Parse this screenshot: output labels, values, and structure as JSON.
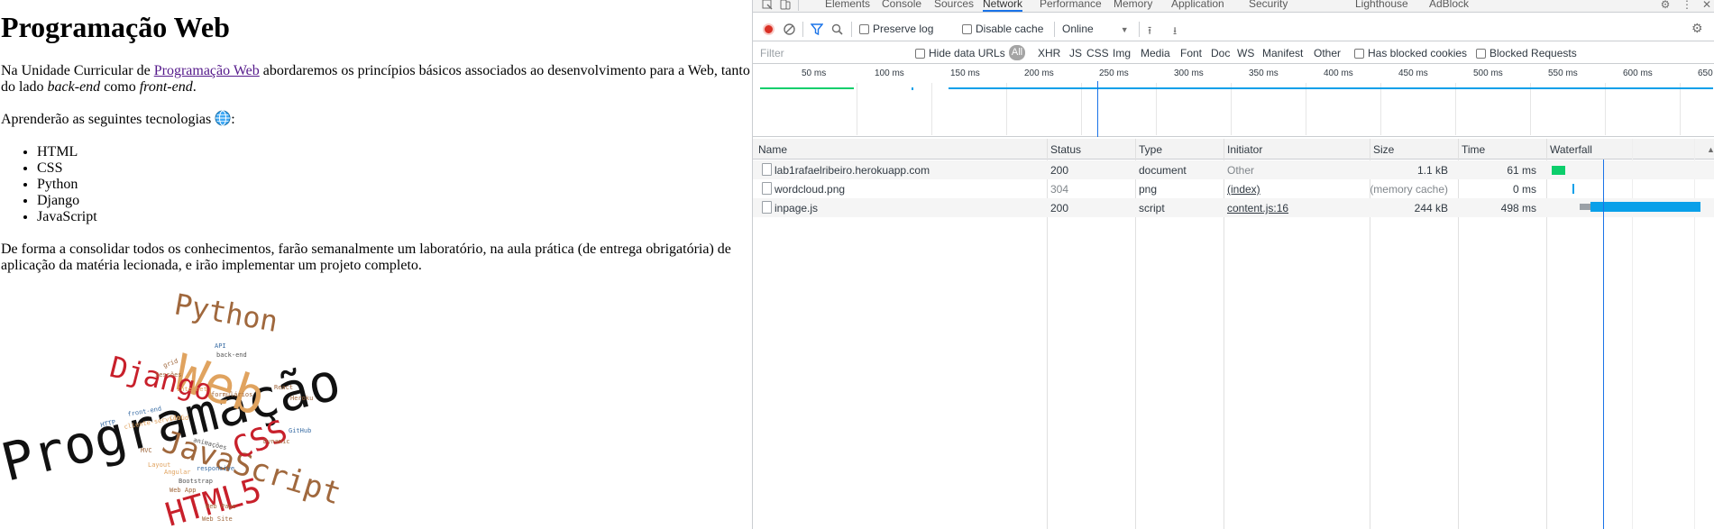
{
  "page": {
    "title": "Programação Web",
    "intro": {
      "before_link": "Na Unidade Curricular de ",
      "link_text": "Programação Web",
      "after_link": " abordaremos os princípios básicos associados ao desenvolvimento para a Web, tanto do lado ",
      "em1": "back-end",
      "middle": " como ",
      "em2": "front-end",
      "end": "."
    },
    "learn": {
      "text": "Aprenderão as seguintes tecnologias ",
      "suffix": ":"
    },
    "technologies": [
      "HTML",
      "CSS",
      "Python",
      "Django",
      "JavaScript"
    ],
    "closing": "De forma a consolidar todos os conhecimentos, farão semanalmente um laboratório, na aula prática (de entrega obrigatória) de aplicação da matéria lecionada, e irão implementar um projeto completo.",
    "wordcloud_words": [
      "Programação",
      "Web",
      "Python",
      "Django",
      "JavaScript",
      "CSS",
      "HTML5",
      "API",
      "back-end",
      "grid",
      "Sessões",
      "Internet",
      "formulários",
      "React",
      "HTTP",
      "front-end",
      "cliente-servidor",
      "MVC",
      "Cloud",
      "animações",
      "Heroku",
      "Layout",
      "Angular",
      "responsive",
      "Bootstrap",
      "Web App",
      "Web Page",
      "Web Site",
      "GitHub",
      "Dynamic"
    ]
  },
  "devtools": {
    "tabs": [
      "Elements",
      "Console",
      "Sources",
      "Network",
      "Performance",
      "Memory",
      "Application",
      "Security",
      "Lighthouse",
      "AdBlock"
    ],
    "active_tab": "Network",
    "toolbar": {
      "preserve_log": "Preserve log",
      "disable_cache": "Disable cache",
      "throttling": "Online"
    },
    "filter": {
      "placeholder": "Filter",
      "hide_data_urls": "Hide data URLs",
      "all": "All",
      "types": [
        "XHR",
        "JS",
        "CSS",
        "Img",
        "Media",
        "Font",
        "Doc",
        "WS",
        "Manifest",
        "Other"
      ],
      "has_blocked_cookies": "Has blocked cookies",
      "blocked_requests": "Blocked Requests"
    },
    "overview_ticks": [
      "50 ms",
      "100 ms",
      "150 ms",
      "200 ms",
      "250 ms",
      "300 ms",
      "350 ms",
      "400 ms",
      "450 ms",
      "500 ms",
      "550 ms",
      "600 ms",
      "650"
    ],
    "columns": [
      "Name",
      "Status",
      "Type",
      "Initiator",
      "Size",
      "Time",
      "Waterfall"
    ],
    "requests": [
      {
        "name": "lab1rafaelribeiro.herokuapp.com",
        "status": "200",
        "type": "document",
        "initiator": "Other",
        "size": "1.1 kB",
        "time": "61 ms"
      },
      {
        "name": "wordcloud.png",
        "status": "304",
        "type": "png",
        "initiator": "(index)",
        "size": "(memory cache)",
        "time": "0 ms"
      },
      {
        "name": "inpage.js",
        "status": "200",
        "type": "script",
        "initiator": "content.js:16",
        "size": "244 kB",
        "time": "498 ms"
      }
    ],
    "colors": {
      "record": "#d93025",
      "accent": "#1a73e8",
      "doc_bar": "#0cce6b",
      "script_bar": "#0aa0e9",
      "wait_bar": "#9aa0a6"
    },
    "icons": [
      "inspect-icon",
      "device-toolbar-icon",
      "settings-icon",
      "more-icon",
      "close-icon",
      "record-icon",
      "clear-icon",
      "filter-icon",
      "search-icon",
      "import-icon",
      "export-icon",
      "file-icon",
      "sort-icon"
    ]
  }
}
